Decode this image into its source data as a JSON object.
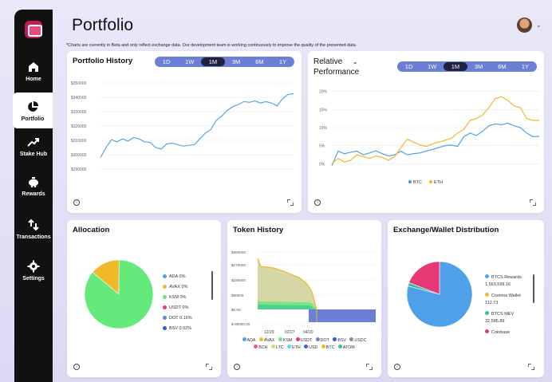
{
  "page": {
    "title": "Portfolio",
    "notice": "*Charts are currently in Beta and only reflect exchange data. Our development team is working continuously to improve the quality of the presented data."
  },
  "sidebar": {
    "items": [
      {
        "label": "Home",
        "icon": "home-icon"
      },
      {
        "label": "Portfolio",
        "icon": "pie-chart-icon",
        "active": true
      },
      {
        "label": "Stake Hub",
        "icon": "trend-up-icon"
      },
      {
        "label": "Rewards",
        "icon": "piggy-bank-icon"
      },
      {
        "label": "Transactions",
        "icon": "transfer-arrows-icon"
      },
      {
        "label": "Settings",
        "icon": "gear-icon"
      }
    ]
  },
  "time_ranges": [
    "1D",
    "1W",
    "1M",
    "3M",
    "6M",
    "1Y"
  ],
  "selected_range": "1M",
  "colors": {
    "accent": "#6b7fd4",
    "line": "#5aa5e8",
    "btc": "#4ea1e8",
    "eth": "#f1b827"
  },
  "cards": {
    "portfolio_history": {
      "title": "Portfolio History"
    },
    "relative_performance": {
      "title_line1": "Relative",
      "title_line2": "Performance"
    },
    "allocation": {
      "title": "Allocation"
    },
    "token_history": {
      "title": "Token History"
    },
    "exchange_distribution": {
      "title": "Exchange/Wallet Distribution"
    }
  },
  "chart_data": [
    {
      "id": "portfolio-history",
      "type": "line",
      "y_ticks": [
        "$350000",
        "$340000",
        "$330000",
        "$320000",
        "$310000",
        "$300000",
        "$290000"
      ],
      "ylim": [
        290000,
        350000
      ],
      "values": [
        298000,
        305000,
        310500,
        309000,
        311000,
        309500,
        312000,
        311000,
        309000,
        308500,
        305000,
        304000,
        307500,
        308000,
        307000,
        306000,
        306500,
        307000,
        311000,
        315000,
        317500,
        324000,
        327000,
        331000,
        333500,
        335000,
        337000,
        336500,
        337500,
        336000,
        337000,
        336000,
        334000,
        339000,
        342000,
        342500
      ]
    },
    {
      "id": "relative-performance",
      "type": "line",
      "y_ticks": [
        "20%",
        "15%",
        "10%",
        "5%",
        "0%"
      ],
      "ylim": [
        -1,
        21
      ],
      "series": [
        {
          "name": "BTC",
          "values": [
            -0.5,
            3.5,
            2.8,
            3.2,
            3.5,
            2.5,
            3.0,
            3.6,
            2.8,
            2.2,
            2.5,
            3.5,
            2.5,
            2.8,
            3.0,
            3.5,
            4.0,
            4.5,
            5.0,
            5.2,
            4.8,
            7.5,
            8.5,
            7.8,
            9.0,
            10.5,
            11.0,
            10.8,
            11.2,
            10.5,
            10.0,
            8.5,
            7.5,
            7.6
          ]
        },
        {
          "name": "ETH",
          "values": [
            0.0,
            1.5,
            0.5,
            1.0,
            2.5,
            2.0,
            1.5,
            2.2,
            1.8,
            1.0,
            2.0,
            4.5,
            6.8,
            6.0,
            5.2,
            4.8,
            5.5,
            6.0,
            6.5,
            7.0,
            8.5,
            9.5,
            12.0,
            12.5,
            13.5,
            15.5,
            18.0,
            18.5,
            17.5,
            16.0,
            15.5,
            12.5,
            12.0,
            12.0
          ]
        }
      ]
    },
    {
      "id": "allocation",
      "type": "pie",
      "slices": [
        {
          "name": "ADA",
          "value": 0,
          "label": "ADA 0%",
          "color": "#4ea1e8"
        },
        {
          "name": "AVAX",
          "value": 14,
          "label": "AVAX 0%",
          "color": "#f1b827"
        },
        {
          "name": "KSM",
          "value": 86,
          "label": "KSM 0%",
          "color": "#63ea7a"
        },
        {
          "name": "USDT",
          "value": 0,
          "label": "USDT 0%",
          "color": "#e73975"
        },
        {
          "name": "DOT",
          "value": 0,
          "label": "DOT 0.16%",
          "color": "#6b7fd4"
        },
        {
          "name": "BSV",
          "value": 0,
          "label": "BSV 0.02%",
          "color": "#2c5ad8"
        }
      ]
    },
    {
      "id": "token-history",
      "type": "area",
      "y_ticks": [
        "$360000",
        "$270000",
        "$180000",
        "$90000",
        "$0.00",
        "$-90000.00"
      ],
      "x_ticks": [
        "12/29",
        "02/27",
        "04/20"
      ],
      "legend": [
        {
          "name": "ADA",
          "color": "#4ea1e8"
        },
        {
          "name": "AVAX",
          "color": "#f1b827"
        },
        {
          "name": "KSM",
          "color": "#63ea7a"
        },
        {
          "name": "USDT",
          "color": "#e73975"
        },
        {
          "name": "DOT",
          "color": "#6b7fd4"
        },
        {
          "name": "BSV",
          "color": "#2c5ad8"
        },
        {
          "name": "USDC",
          "color": "#8a8f9c"
        },
        {
          "name": "BCH",
          "color": "#f05a78"
        },
        {
          "name": "LTC",
          "color": "#c9e27a"
        },
        {
          "name": "ETH",
          "color": "#63d1f0"
        },
        {
          "name": "USD",
          "color": "#3b63d8"
        },
        {
          "name": "BTC",
          "color": "#f1b827"
        },
        {
          "name": "ATOM",
          "color": "#2ec2a0"
        }
      ]
    },
    {
      "id": "exchange-distribution",
      "type": "pie",
      "slices": [
        {
          "name": "BTCS Rewards",
          "value": 1563599.16,
          "label": "BTCS Rewards",
          "amount": "1,563,599.16",
          "color": "#4ea1e8"
        },
        {
          "name": "Cosmos Wallet",
          "value": 112.73,
          "label": "Cosmos Wallet",
          "amount": "112.73",
          "color": "#f1b827"
        },
        {
          "name": "BTCS MEV",
          "value": 32585.89,
          "label": "BTCS MEV",
          "amount": "32,585.89",
          "color": "#2ec2a0"
        },
        {
          "name": "Coinbase",
          "value": 380000,
          "label": "Coinbase",
          "color": "#e73975"
        }
      ]
    }
  ]
}
